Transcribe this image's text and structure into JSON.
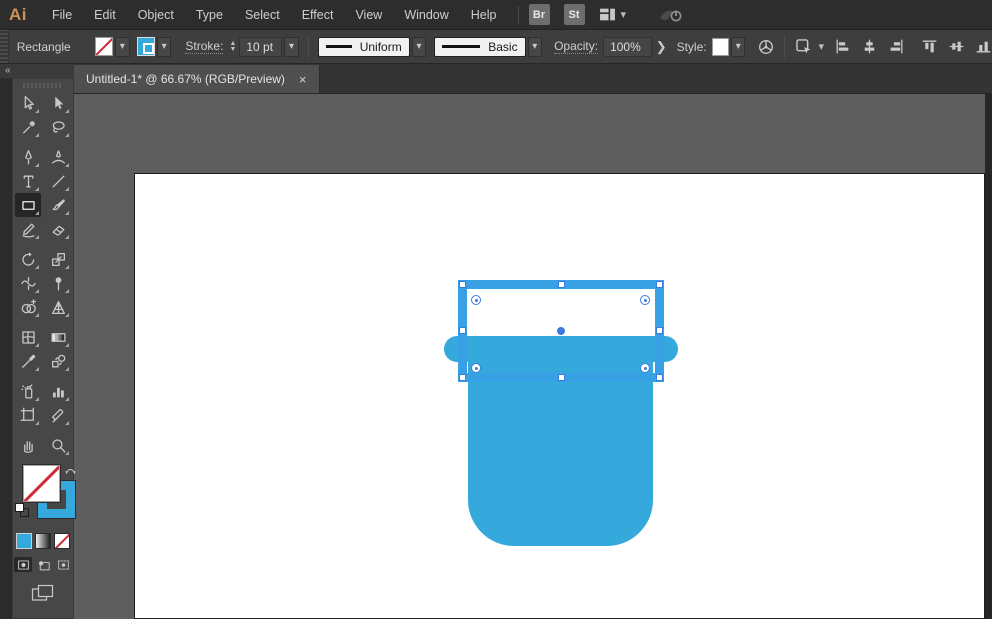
{
  "app": {
    "logo_text": "Ai"
  },
  "menubar": {
    "items": [
      "File",
      "Edit",
      "Object",
      "Type",
      "Select",
      "Effect",
      "View",
      "Window",
      "Help"
    ],
    "bridge_button": "Br",
    "stock_button": "St",
    "icons": [
      "workspace-switcher-icon",
      "chevron-down-icon",
      "power-status-icon"
    ]
  },
  "control_bar": {
    "tool_label": "Rectangle",
    "fill_swatch": "none",
    "stroke_swatch_color": "blue",
    "stroke_label": "Stroke:",
    "stroke_value": "10 pt",
    "variable_width_value": "Uniform",
    "brush_value": "Basic",
    "opacity_label": "Opacity:",
    "opacity_value": "100%",
    "style_label": "Style:",
    "icons": [
      "recolor-artwork-icon",
      "shape-menu-icon",
      "align-left-icon",
      "align-center-h-icon",
      "align-right-icon",
      "align-top-icon",
      "align-middle-v-icon",
      "align-bottom-icon"
    ]
  },
  "document_tab": {
    "title": "Untitled-1* @ 66.67% (RGB/Preview)",
    "name": "Untitled-1*",
    "zoom_percent": "66.67%",
    "color_mode": "RGB/Preview",
    "close_glyph": "×"
  },
  "toolbar": {
    "collapse_glyph": "«",
    "tools": [
      {
        "name": "selection"
      },
      {
        "name": "direct-selection"
      },
      {
        "name": "magic-wand"
      },
      {
        "name": "lasso"
      },
      {
        "name": "pen"
      },
      {
        "name": "curvature"
      },
      {
        "name": "type"
      },
      {
        "name": "line-segment"
      },
      {
        "name": "rectangle",
        "selected": true
      },
      {
        "name": "paintbrush"
      },
      {
        "name": "shaper"
      },
      {
        "name": "eraser"
      },
      {
        "name": "rotate"
      },
      {
        "name": "scale"
      },
      {
        "name": "width"
      },
      {
        "name": "puppet-warp"
      },
      {
        "name": "shape-builder"
      },
      {
        "name": "perspective-grid"
      },
      {
        "name": "mesh"
      },
      {
        "name": "gradient"
      },
      {
        "name": "eyedropper"
      },
      {
        "name": "blend"
      },
      {
        "name": "symbol-sprayer"
      },
      {
        "name": "column-graph"
      },
      {
        "name": "artboard"
      },
      {
        "name": "slice"
      },
      {
        "name": "hand"
      },
      {
        "name": "zoom"
      }
    ],
    "fill_proxy": "none",
    "stroke_proxy": "blue",
    "color_buttons": [
      "color",
      "gradient",
      "none"
    ],
    "drawing_modes": [
      "draw-normal",
      "draw-behind",
      "draw-inside"
    ],
    "active_drawing_mode": "draw-normal"
  },
  "canvas": {
    "artboard_color": "#FFFFFF",
    "artwork": {
      "shape": "bucket",
      "fill": "#35A9DC",
      "selected_rectangle": {
        "fill": "none",
        "stroke_color": "#38A0E4",
        "stroke_weight": "10 pt"
      }
    }
  },
  "colors": {
    "artwork_blue": "#35A9DC",
    "stroke_blue": "#38A0E4",
    "selection_blue": "#3B7BE0",
    "none_red": "#CE2B37",
    "logo_orange": "#CE9159",
    "pasteboard": "#5E5E5E"
  }
}
